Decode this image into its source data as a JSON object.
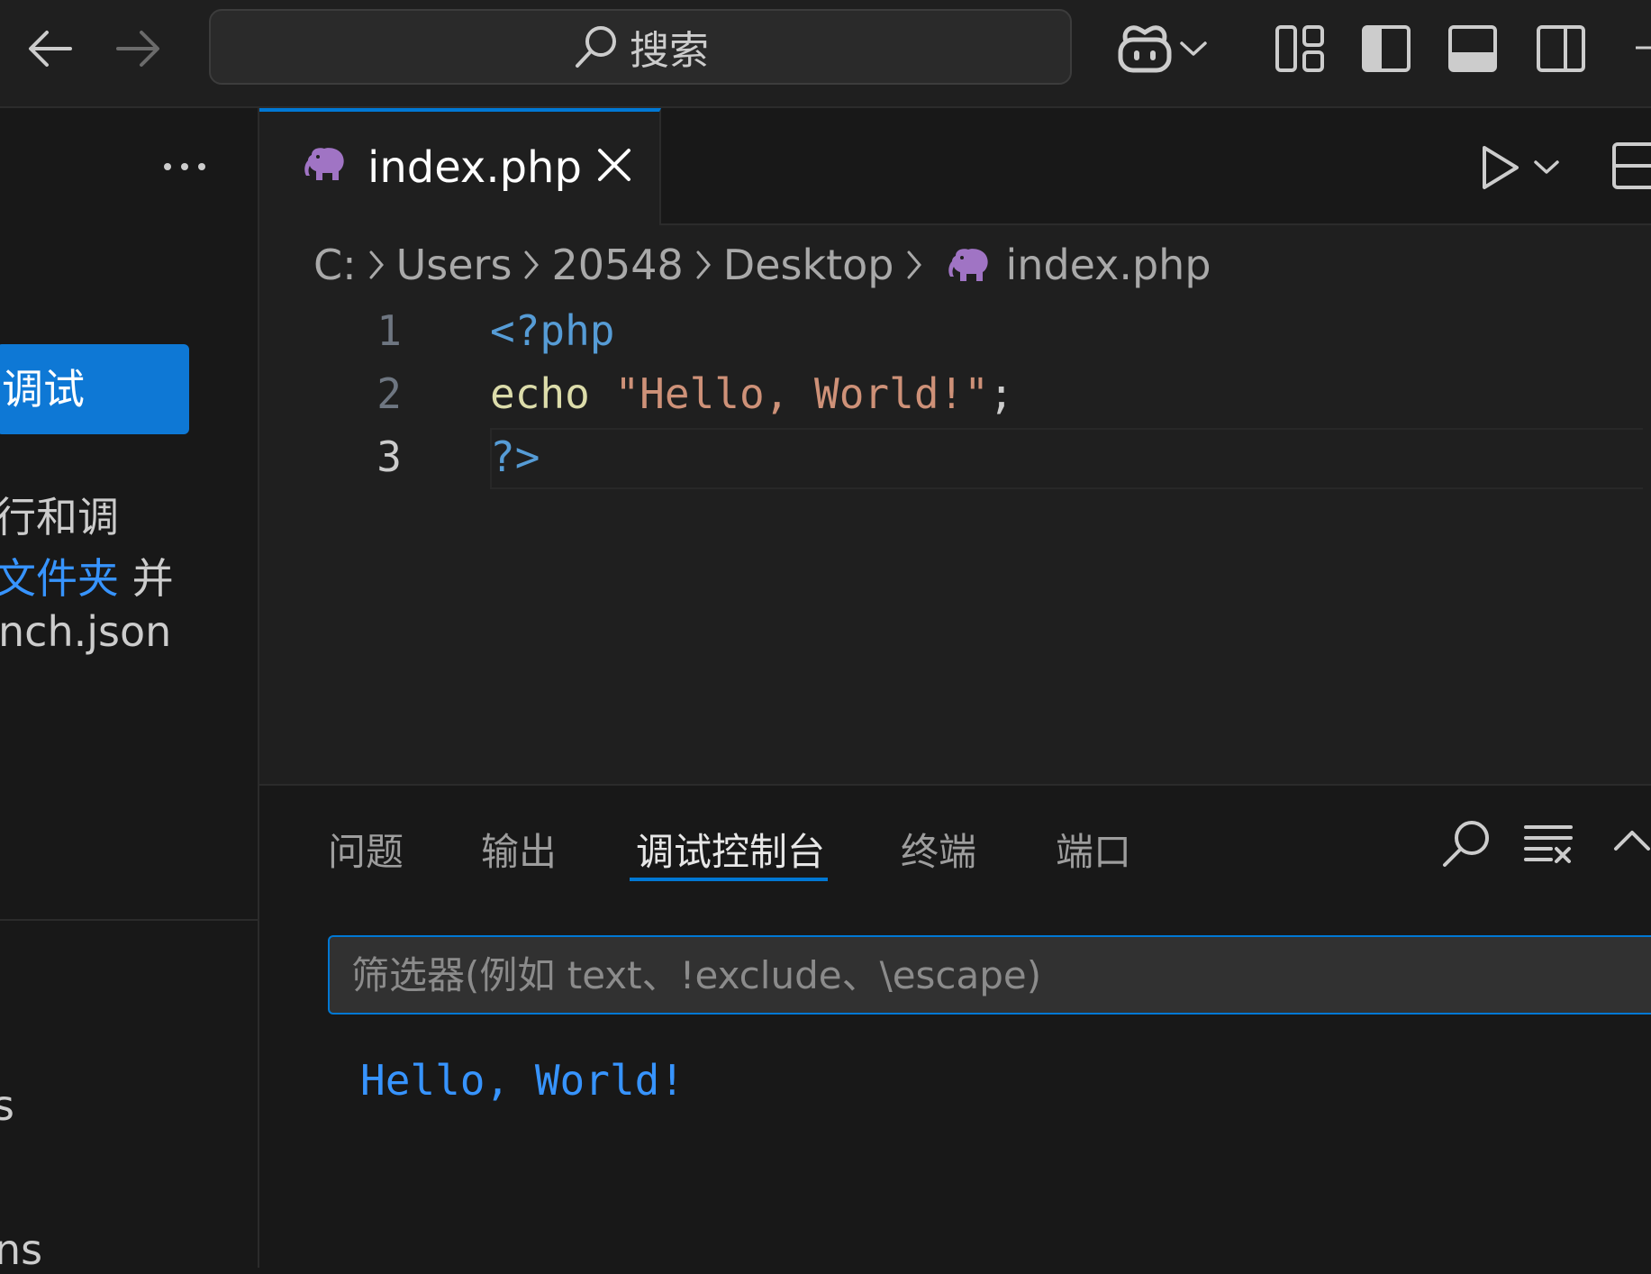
{
  "titlebar": {
    "search_label": "搜索"
  },
  "sidebar": {
    "run_debug_button": "调试",
    "description_line1": "行和调",
    "description_link": "文件夹",
    "description_line2_suffix": " 并",
    "description_line3": "nch.json",
    "lower_item1": "s",
    "lower_item2": "ns"
  },
  "editor": {
    "tab_label": "index.php",
    "breadcrumb": [
      "C:",
      "Users",
      "20548",
      "Desktop",
      "index.php"
    ],
    "lines": [
      {
        "num": "1",
        "tokens": [
          {
            "text": "<?php",
            "color": "#569cd6"
          }
        ]
      },
      {
        "num": "2",
        "tokens": [
          {
            "text": "echo ",
            "color": "#dcdcaa"
          },
          {
            "text": "\"Hello, World!\"",
            "color": "#ce9178"
          },
          {
            "text": ";",
            "color": "#cccccc"
          }
        ]
      },
      {
        "num": "3",
        "tokens": [
          {
            "text": "?>",
            "color": "#569cd6"
          }
        ]
      }
    ]
  },
  "panel": {
    "tabs": [
      "问题",
      "输出",
      "调试控制台",
      "终端",
      "端口"
    ],
    "active_tab": "调试控制台",
    "filter_placeholder": "筛选器(例如 text、!exclude、\\escape)",
    "output": "Hello, World!"
  },
  "colors": {
    "accent": "#0078d4",
    "php_icon": "#a074c4",
    "link": "#3794ff"
  }
}
